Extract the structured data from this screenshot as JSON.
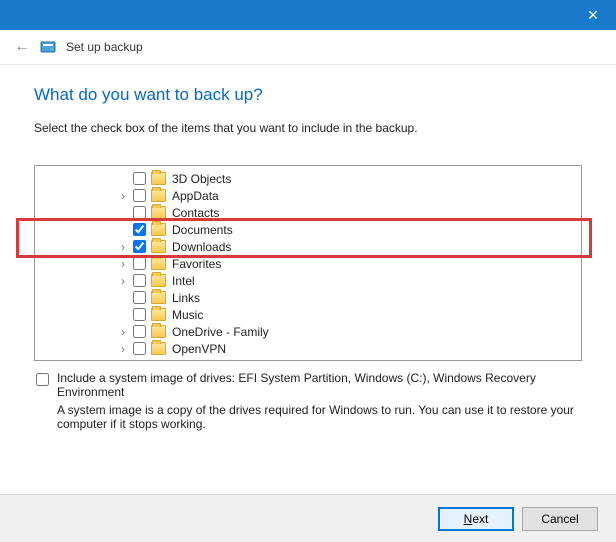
{
  "titlebar": {
    "close_glyph": "✕"
  },
  "header": {
    "title": "Set up backup"
  },
  "main": {
    "title": "What do you want to back up?",
    "instruction": "Select the check box of the items that you want to include in the backup."
  },
  "tree": {
    "items": [
      {
        "label": "3D Objects",
        "checked": false,
        "expandable": false
      },
      {
        "label": "AppData",
        "checked": false,
        "expandable": true
      },
      {
        "label": "Contacts",
        "checked": false,
        "expandable": false
      },
      {
        "label": "Documents",
        "checked": true,
        "expandable": false
      },
      {
        "label": "Downloads",
        "checked": true,
        "expandable": true
      },
      {
        "label": "Favorites",
        "checked": false,
        "expandable": true
      },
      {
        "label": "Intel",
        "checked": false,
        "expandable": true
      },
      {
        "label": "Links",
        "checked": false,
        "expandable": false
      },
      {
        "label": "Music",
        "checked": false,
        "expandable": false
      },
      {
        "label": "OneDrive - Family",
        "checked": false,
        "expandable": true
      },
      {
        "label": "OpenVPN",
        "checked": false,
        "expandable": true
      }
    ]
  },
  "sysimage": {
    "checked": false,
    "label": "Include a system image of drives: EFI System Partition, Windows (C:), Windows Recovery Environment",
    "description": "A system image is a copy of the drives required for Windows to run. You can use it to restore your computer if it stops working."
  },
  "footer": {
    "next": "Next",
    "cancel": "Cancel"
  }
}
